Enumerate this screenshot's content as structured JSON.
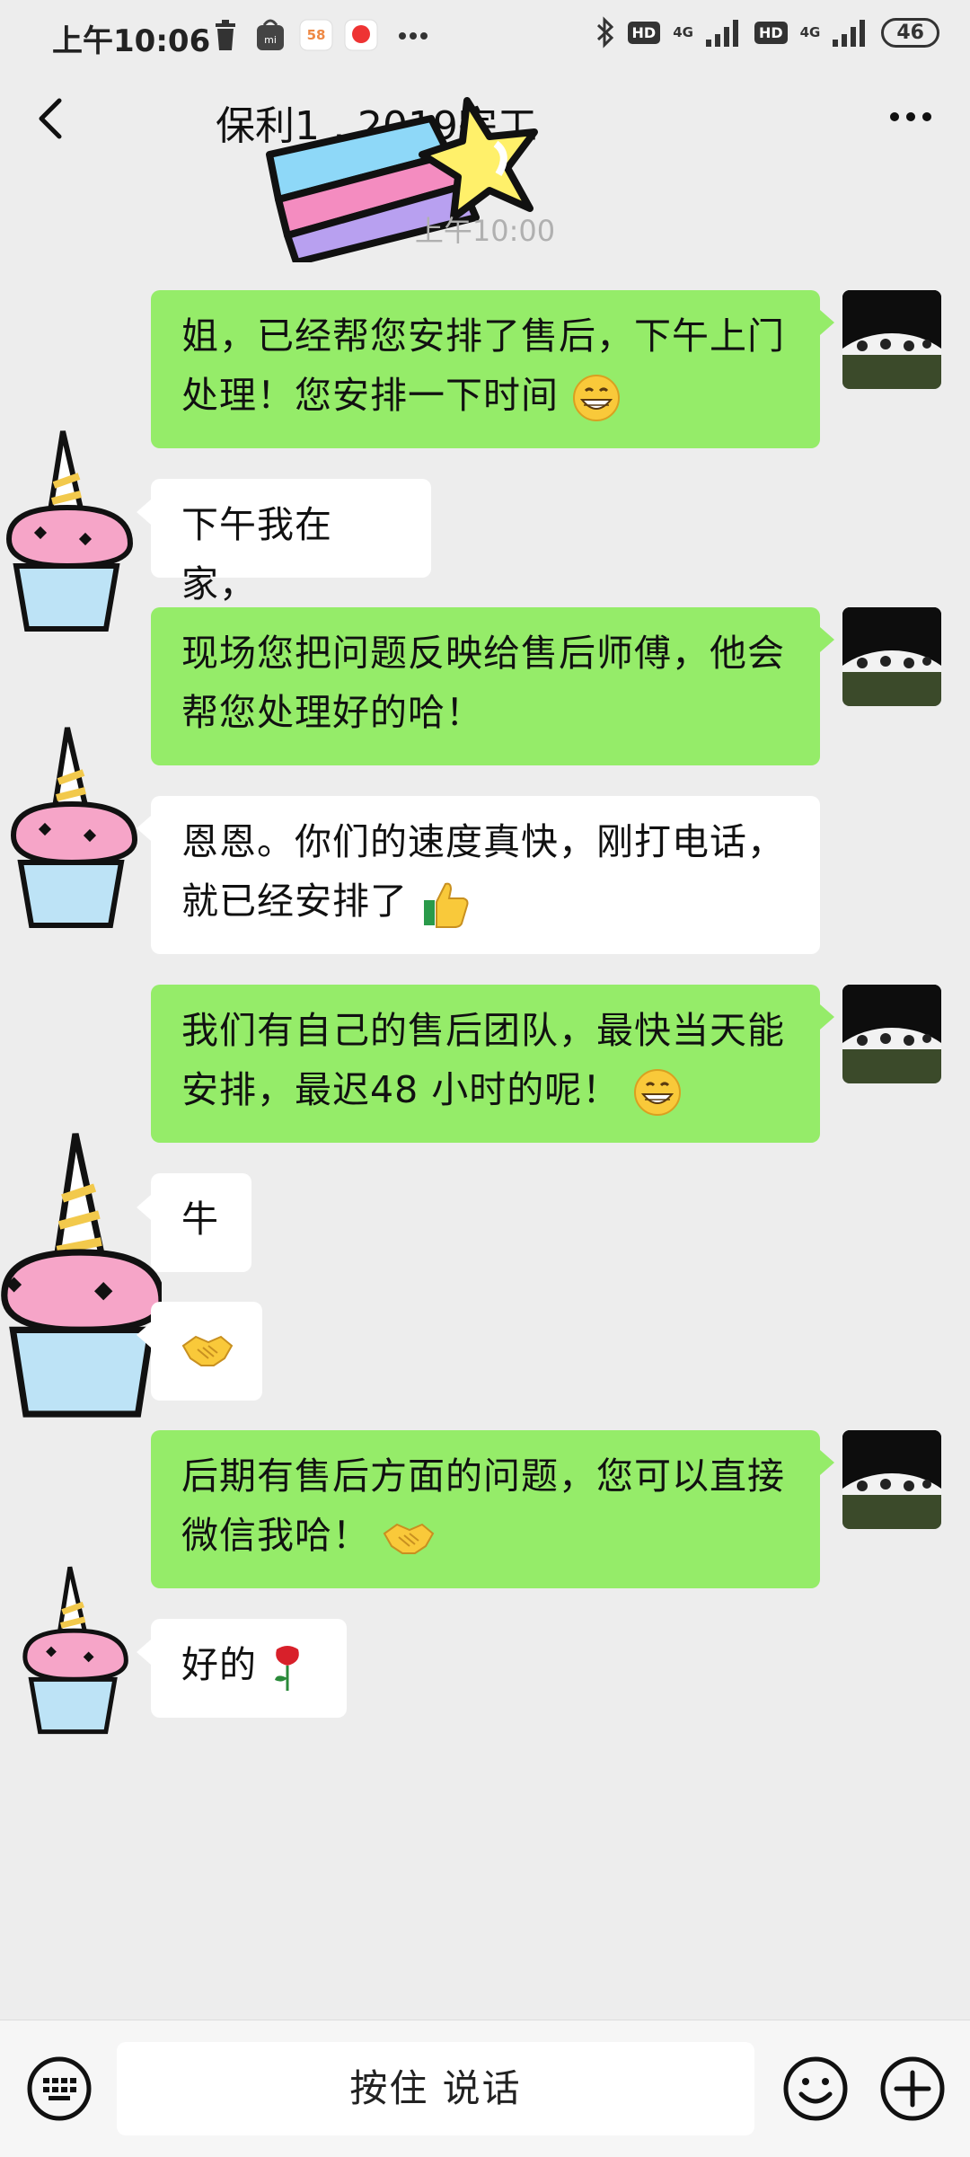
{
  "status_bar": {
    "time": "上午10:06",
    "network_1": "HD",
    "network_2": "4G",
    "network_3": "HD",
    "network_4": "4G",
    "battery": "46"
  },
  "header": {
    "title": "保利1  , 2019完工"
  },
  "time_divider": "上午10:00",
  "messages": [
    {
      "side": "out",
      "text": "姐，已经帮您安排了售后，下午上门处理！您安排一下时间",
      "emoji": "grin"
    },
    {
      "side": "in",
      "text": "下午我在家，",
      "emoji": ""
    },
    {
      "side": "out",
      "text": "现场您把问题反映给售后师傅，他会帮您处理好的哈！",
      "emoji": ""
    },
    {
      "side": "in",
      "text": "恩恩。你们的速度真快，刚打电话，就已经安排了",
      "emoji": "thumbs-up"
    },
    {
      "side": "out",
      "text": "我们有自己的售后团队，最快当天能安排，最迟48 小时的呢！",
      "emoji": "grin"
    },
    {
      "side": "in",
      "text": "牛",
      "emoji": ""
    },
    {
      "side": "in",
      "text": "",
      "emoji": "handshake"
    },
    {
      "side": "out",
      "text": "后期有售后方面的问题，您可以直接微信我哈！",
      "emoji": "handshake"
    },
    {
      "side": "in",
      "text": "好的",
      "emoji": "rose"
    }
  ],
  "input_bar": {
    "hold_to_talk": "按住 说话"
  },
  "colors": {
    "out_bubble": "#95ec69",
    "in_bubble": "#ffffff",
    "background": "#ededed"
  }
}
